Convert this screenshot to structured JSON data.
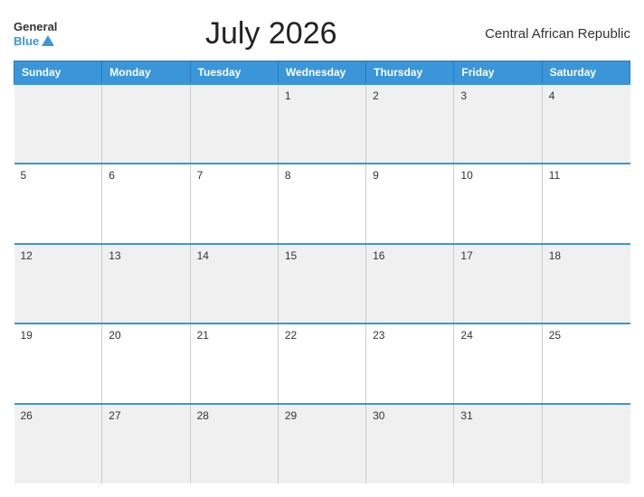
{
  "header": {
    "logo_general": "General",
    "logo_blue": "Blue",
    "title": "July 2026",
    "country": "Central African Republic"
  },
  "weekdays": [
    "Sunday",
    "Monday",
    "Tuesday",
    "Wednesday",
    "Thursday",
    "Friday",
    "Saturday"
  ],
  "weeks": [
    [
      "",
      "",
      "",
      "1",
      "2",
      "3",
      "4"
    ],
    [
      "5",
      "6",
      "7",
      "8",
      "9",
      "10",
      "11"
    ],
    [
      "12",
      "13",
      "14",
      "15",
      "16",
      "17",
      "18"
    ],
    [
      "19",
      "20",
      "21",
      "22",
      "23",
      "24",
      "25"
    ],
    [
      "26",
      "27",
      "28",
      "29",
      "30",
      "31",
      ""
    ]
  ]
}
